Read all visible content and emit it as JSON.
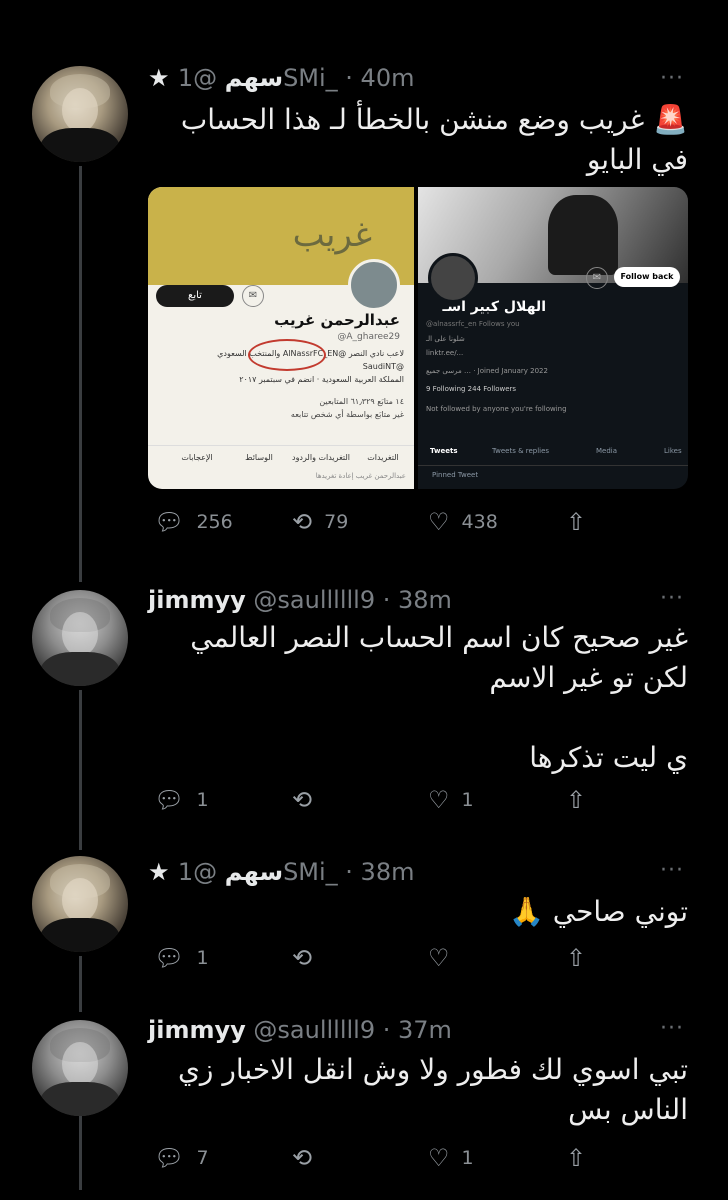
{
  "tweets": [
    {
      "name": "★ سهم",
      "handle": "@1SMi_ · 40m",
      "lines": [
        "🚨 غريب وضع منشن بالخطأ لـ هذا الحساب",
        "في البايو"
      ],
      "replies": "256",
      "retweets": "79",
      "likes": "438"
    },
    {
      "name": "jimmyy",
      "handle": "@saullllll9 · 38m",
      "lines": [
        "غير صحيح كان اسم الحساب النصر العالمي",
        "لكن تو غير الاسم",
        "",
        "ي ليت تذكرها"
      ],
      "replies": "1",
      "retweets": "",
      "likes": "1"
    },
    {
      "name": "★ سهم",
      "handle": "@1SMi_ · 38m",
      "lines": [
        "توني صاحي 🙏"
      ],
      "replies": "1",
      "retweets": "",
      "likes": ""
    },
    {
      "name": "jimmyy",
      "handle": "@saullllll9 · 37m",
      "lines": [
        "تبي اسوي لك فطور ولا وش انقل الاخبار زي",
        "الناس بس"
      ],
      "replies": "7",
      "retweets": "",
      "likes": "1"
    }
  ],
  "more_glyph": "···",
  "icons": {
    "reply": "reply-icon",
    "retweet": "retweet-icon",
    "like": "heart-icon",
    "share": "share-icon"
  },
  "embed_left": {
    "banner_text": "غريب",
    "follow": "تابع",
    "name": "عبدالرحمن غريب",
    "handle": "@A_gharee29",
    "bio_1": "لاعب نادي النصر @AlNassrFC_EN والمنتخب السعودي",
    "bio_2": "@SaudiNT",
    "location": "المملكة العربية السعودية",
    "joined": "انضم في سبتمبر ٢٠١٧",
    "stats": "١٤ متابَع   ٦١٫٣٢٩ المتابعين",
    "followed_by": "غير متابَع بواسطة أي شخص تتابعه",
    "tabs": [
      "التغريدات",
      "التغريدات والردود",
      "الوسائط",
      "الإعجابات"
    ],
    "footer": "عبدالرحمن غريب إعادة تغريدها"
  },
  "embed_right": {
    "follow": "Follow back",
    "name": "الهلال كبير اسـ",
    "handle": "@alnassrfc_en   Follows you",
    "bio": "شلونا على الـ",
    "link": "linktr.ee/...",
    "location": "مرسى جميع …",
    "joined": "Joined January 2022",
    "stats": "9 Following   244 Followers",
    "followed_by": "Not followed by anyone you're following",
    "tabs": [
      "Tweets",
      "Tweets & replies",
      "Media",
      "Likes"
    ],
    "pinned": "Pinned Tweet"
  },
  "colors": {
    "background": "#000000",
    "text": "#e7e9ea",
    "muted": "#7a7f84",
    "thread_line": "#3a3d40"
  }
}
